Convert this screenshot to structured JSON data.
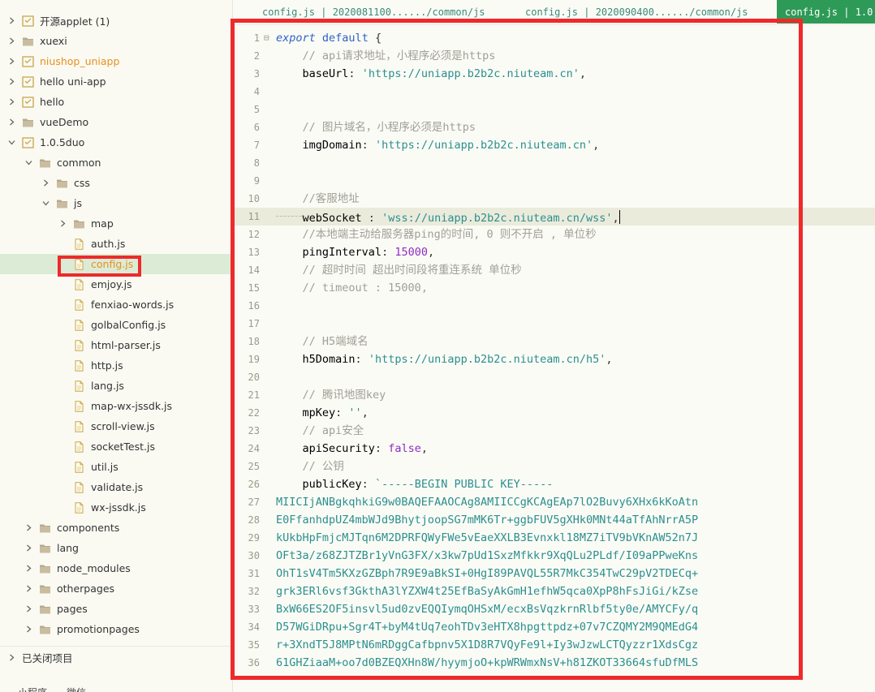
{
  "sidebar": {
    "items": [
      {
        "label": "开源applet (1)",
        "depth": 0,
        "expanded": false,
        "icon": "project-icon",
        "style": "normal",
        "selected": false
      },
      {
        "label": "xuexi",
        "depth": 0,
        "expanded": false,
        "icon": "folder-icon",
        "style": "normal",
        "selected": false
      },
      {
        "label": "niushop_uniapp",
        "depth": 0,
        "expanded": false,
        "icon": "project-icon",
        "style": "orange",
        "selected": false
      },
      {
        "label": "hello uni-app",
        "depth": 0,
        "expanded": false,
        "icon": "project-icon",
        "style": "normal",
        "selected": false
      },
      {
        "label": "hello",
        "depth": 0,
        "expanded": false,
        "icon": "project-icon",
        "style": "normal",
        "selected": false
      },
      {
        "label": "vueDemo",
        "depth": 0,
        "expanded": false,
        "icon": "folder-icon",
        "style": "normal",
        "selected": false
      },
      {
        "label": "1.0.5duo",
        "depth": 0,
        "expanded": true,
        "icon": "project-icon",
        "style": "normal",
        "selected": false
      },
      {
        "label": "common",
        "depth": 1,
        "expanded": true,
        "icon": "folder-icon",
        "style": "normal",
        "selected": false
      },
      {
        "label": "css",
        "depth": 2,
        "expanded": false,
        "icon": "folder-icon",
        "style": "normal",
        "selected": false
      },
      {
        "label": "js",
        "depth": 2,
        "expanded": true,
        "icon": "folder-icon",
        "style": "normal",
        "selected": false
      },
      {
        "label": "map",
        "depth": 3,
        "expanded": false,
        "icon": "folder-icon",
        "style": "normal",
        "selected": false
      },
      {
        "label": "auth.js",
        "depth": 3,
        "expanded": null,
        "icon": "file-icon",
        "style": "normal",
        "selected": false
      },
      {
        "label": "config.js",
        "depth": 3,
        "expanded": null,
        "icon": "file-icon",
        "style": "orange",
        "selected": true
      },
      {
        "label": "emjoy.js",
        "depth": 3,
        "expanded": null,
        "icon": "file-icon",
        "style": "normal",
        "selected": false
      },
      {
        "label": "fenxiao-words.js",
        "depth": 3,
        "expanded": null,
        "icon": "file-icon",
        "style": "normal",
        "selected": false
      },
      {
        "label": "golbalConfig.js",
        "depth": 3,
        "expanded": null,
        "icon": "file-icon",
        "style": "normal",
        "selected": false
      },
      {
        "label": "html-parser.js",
        "depth": 3,
        "expanded": null,
        "icon": "file-icon",
        "style": "normal",
        "selected": false
      },
      {
        "label": "http.js",
        "depth": 3,
        "expanded": null,
        "icon": "file-icon",
        "style": "normal",
        "selected": false
      },
      {
        "label": "lang.js",
        "depth": 3,
        "expanded": null,
        "icon": "file-icon",
        "style": "normal",
        "selected": false
      },
      {
        "label": "map-wx-jssdk.js",
        "depth": 3,
        "expanded": null,
        "icon": "file-icon",
        "style": "normal",
        "selected": false
      },
      {
        "label": "scroll-view.js",
        "depth": 3,
        "expanded": null,
        "icon": "file-icon",
        "style": "normal",
        "selected": false
      },
      {
        "label": "socketTest.js",
        "depth": 3,
        "expanded": null,
        "icon": "file-icon",
        "style": "normal",
        "selected": false
      },
      {
        "label": "util.js",
        "depth": 3,
        "expanded": null,
        "icon": "file-icon",
        "style": "normal",
        "selected": false
      },
      {
        "label": "validate.js",
        "depth": 3,
        "expanded": null,
        "icon": "file-icon",
        "style": "normal",
        "selected": false
      },
      {
        "label": "wx-jssdk.js",
        "depth": 3,
        "expanded": null,
        "icon": "file-icon",
        "style": "normal",
        "selected": false
      },
      {
        "label": "components",
        "depth": 1,
        "expanded": false,
        "icon": "folder-icon",
        "style": "normal",
        "selected": false
      },
      {
        "label": "lang",
        "depth": 1,
        "expanded": false,
        "icon": "folder-icon",
        "style": "normal",
        "selected": false
      },
      {
        "label": "node_modules",
        "depth": 1,
        "expanded": false,
        "icon": "folder-icon",
        "style": "normal",
        "selected": false
      },
      {
        "label": "otherpages",
        "depth": 1,
        "expanded": false,
        "icon": "folder-icon",
        "style": "normal",
        "selected": false
      },
      {
        "label": "pages",
        "depth": 1,
        "expanded": false,
        "icon": "folder-icon",
        "style": "normal",
        "selected": false
      },
      {
        "label": "promotionpages",
        "depth": 1,
        "expanded": false,
        "icon": "folder-icon",
        "style": "normal",
        "selected": false
      }
    ],
    "closed_projects_label": "已关闭项目",
    "bottom_tabs": [
      "小程序",
      "微信"
    ]
  },
  "tabs": [
    {
      "label": "config.js | 2020081100....../common/js",
      "active": false
    },
    {
      "label": "config.js | 2020090400....../common/js",
      "active": false
    },
    {
      "label": "config.js | 1.0",
      "active": true
    }
  ],
  "editor": {
    "current_line": 11,
    "lines": [
      {
        "n": "1",
        "fold": "⊟",
        "tokens": [
          [
            "kw",
            "export"
          ],
          [
            "punct",
            " "
          ],
          [
            "def",
            "default"
          ],
          [
            "punct",
            " {"
          ]
        ]
      },
      {
        "n": "2",
        "tokens": [
          [
            "punct",
            "    "
          ],
          [
            "cmt",
            "// api请求地址，小程序必须是https"
          ]
        ]
      },
      {
        "n": "3",
        "tokens": [
          [
            "punct",
            "    "
          ],
          [
            "prop",
            "baseUrl"
          ],
          [
            "punct",
            ": "
          ],
          [
            "str",
            "'https://uniapp.b2b2c.niuteam.cn'"
          ],
          [
            "punct",
            ","
          ]
        ]
      },
      {
        "n": "4",
        "tokens": []
      },
      {
        "n": "5",
        "tokens": []
      },
      {
        "n": "6",
        "tokens": [
          [
            "punct",
            "    "
          ],
          [
            "cmt",
            "// 图片域名，小程序必须是https"
          ]
        ]
      },
      {
        "n": "7",
        "tokens": [
          [
            "punct",
            "    "
          ],
          [
            "prop",
            "imgDomain"
          ],
          [
            "punct",
            ": "
          ],
          [
            "str",
            "'https://uniapp.b2b2c.niuteam.cn'"
          ],
          [
            "punct",
            ","
          ]
        ]
      },
      {
        "n": "8",
        "tokens": []
      },
      {
        "n": "9",
        "tokens": []
      },
      {
        "n": "10",
        "tokens": [
          [
            "punct",
            "    "
          ],
          [
            "cmt",
            "//客服地址"
          ]
        ]
      },
      {
        "n": "11",
        "tokens": [
          [
            "punct",
            "    "
          ],
          [
            "prop",
            "webSocket"
          ],
          [
            "punct",
            " : "
          ],
          [
            "str",
            "'wss://uniapp.b2b2c.niuteam.cn/wss'"
          ],
          [
            "punct",
            ","
          ]
        ]
      },
      {
        "n": "12",
        "tokens": [
          [
            "punct",
            "    "
          ],
          [
            "cmt",
            "//本地端主动给服务器ping的时间, 0 则不开启 , 单位秒"
          ]
        ]
      },
      {
        "n": "13",
        "tokens": [
          [
            "punct",
            "    "
          ],
          [
            "prop",
            "pingInterval"
          ],
          [
            "punct",
            ": "
          ],
          [
            "num",
            "15000"
          ],
          [
            "punct",
            ","
          ]
        ]
      },
      {
        "n": "14",
        "tokens": [
          [
            "punct",
            "    "
          ],
          [
            "cmt",
            "// 超时时间 超出时间段将重连系统 单位秒"
          ]
        ]
      },
      {
        "n": "15",
        "tokens": [
          [
            "punct",
            "    "
          ],
          [
            "cmt",
            "// timeout : 15000,"
          ]
        ]
      },
      {
        "n": "16",
        "tokens": []
      },
      {
        "n": "17",
        "tokens": []
      },
      {
        "n": "18",
        "tokens": [
          [
            "punct",
            "    "
          ],
          [
            "cmt",
            "// H5端域名"
          ]
        ]
      },
      {
        "n": "19",
        "tokens": [
          [
            "punct",
            "    "
          ],
          [
            "prop",
            "h5Domain"
          ],
          [
            "punct",
            ": "
          ],
          [
            "str",
            "'https://uniapp.b2b2c.niuteam.cn/h5'"
          ],
          [
            "punct",
            ","
          ]
        ]
      },
      {
        "n": "20",
        "tokens": []
      },
      {
        "n": "21",
        "tokens": [
          [
            "punct",
            "    "
          ],
          [
            "cmt",
            "// 腾讯地图key"
          ]
        ]
      },
      {
        "n": "22",
        "tokens": [
          [
            "punct",
            "    "
          ],
          [
            "prop",
            "mpKey"
          ],
          [
            "punct",
            ": "
          ],
          [
            "str",
            "''"
          ],
          [
            "punct",
            ","
          ]
        ]
      },
      {
        "n": "23",
        "tokens": [
          [
            "punct",
            "    "
          ],
          [
            "cmt",
            "// api安全"
          ]
        ]
      },
      {
        "n": "24",
        "tokens": [
          [
            "punct",
            "    "
          ],
          [
            "prop",
            "apiSecurity"
          ],
          [
            "punct",
            ": "
          ],
          [
            "bool",
            "false"
          ],
          [
            "punct",
            ","
          ]
        ]
      },
      {
        "n": "25",
        "tokens": [
          [
            "punct",
            "    "
          ],
          [
            "cmt",
            "// 公钥"
          ]
        ]
      },
      {
        "n": "26",
        "tokens": [
          [
            "punct",
            "    "
          ],
          [
            "prop",
            "publicKey"
          ],
          [
            "punct",
            ": "
          ],
          [
            "str",
            "`-----BEGIN PUBLIC KEY-----"
          ]
        ]
      },
      {
        "n": "27",
        "tokens": [
          [
            "str",
            "MIICIjANBgkqhkiG9w0BAQEFAAOCAg8AMIICCgKCAgEAp7lO2Buvy6XHx6kKoAtn"
          ]
        ]
      },
      {
        "n": "28",
        "tokens": [
          [
            "str",
            "E0FfanhdpUZ4mbWJd9BhytjoopSG7mMK6Tr+ggbFUV5gXHk0MNt44aTfAhNrrA5P"
          ]
        ]
      },
      {
        "n": "29",
        "tokens": [
          [
            "str",
            "kUkbHpFmjcMJTqn6M2DPRFQWyFWe5vEaeXXLB3Evnxkl18MZ7iTV9bVKnAW52n7J"
          ]
        ]
      },
      {
        "n": "30",
        "tokens": [
          [
            "str",
            "OFt3a/z68ZJTZBr1yVnG3FX/x3kw7pUd1SxzMfkkr9XqQLu2PLdf/I09aPPweKns"
          ]
        ]
      },
      {
        "n": "31",
        "tokens": [
          [
            "str",
            "OhT1sV4Tm5KXzGZBph7R9E9aBkSI+0HgI89PAVQL55R7MkC354TwC29pV2TDECq+"
          ]
        ]
      },
      {
        "n": "32",
        "tokens": [
          [
            "str",
            "grk3ERl6vsf3GkthA3lYZXW4t25EfBaSyAkGmH1efhW5qca0XpP8hFsJiGi/kZse"
          ]
        ]
      },
      {
        "n": "33",
        "tokens": [
          [
            "str",
            "BxW66ES2OF5insvl5ud0zvEQQIymqOHSxM/ecxBsVqzkrnRlbf5ty0e/AMYCFy/q"
          ]
        ]
      },
      {
        "n": "34",
        "tokens": [
          [
            "str",
            "D57WGiDRpu+Sgr4T+byM4tUq7eohTDv3eHTX8hpgttpdz+07v7CZQMY2M9QMEdG4"
          ]
        ]
      },
      {
        "n": "35",
        "tokens": [
          [
            "str",
            "r+3XndT5J8MPtN6mRDggCafbpnv5X1D8R7VQyFe9l+Iy3wJzwLCTQyzzr1XdsCgz"
          ]
        ]
      },
      {
        "n": "36",
        "tokens": [
          [
            "str",
            "61GHZiaaM+oo7d0BZEQXHn8W/hyymjoO+kpWRWmxNsV+h81ZKOT33664sfuDfMLS"
          ]
        ]
      }
    ]
  },
  "colors": {
    "accent": "#2e9a57",
    "annotation_red": "#ee2a2a",
    "selected_row": "#dcebd6",
    "orange_label": "#e8901c"
  }
}
